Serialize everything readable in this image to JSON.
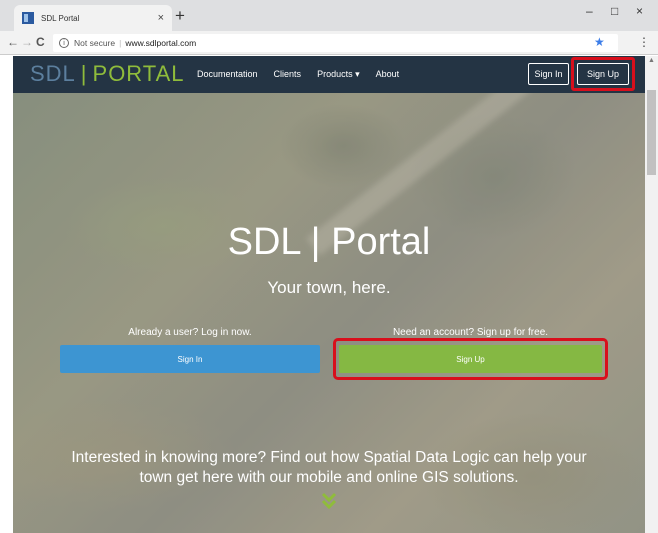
{
  "browser": {
    "tab_title": "SDL Portal",
    "tab_close": "×",
    "new_tab": "+",
    "window_controls": {
      "minimize": "–",
      "maximize": "□",
      "close": "×"
    },
    "nav": {
      "back": "←",
      "forward": "→",
      "reload": "C"
    },
    "security_label": "Not secure",
    "url": "www.sdlportal.com",
    "info_icon": "i"
  },
  "site": {
    "logo": {
      "left": "SDL",
      "separator": "|",
      "right": "PORTAL"
    },
    "nav_links": [
      "Documentation",
      "Clients",
      "Products ▾",
      "About"
    ],
    "sign_in_label": "Sign In",
    "sign_up_label": "Sign Up"
  },
  "hero": {
    "title": "SDL | Portal",
    "subtitle": "Your town, here.",
    "login_prompt": "Already a user? Log in now.",
    "signup_prompt": "Need an account? Sign up for free.",
    "sign_in_button": "Sign In",
    "sign_up_button": "Sign Up",
    "info_line1": "Interested in knowing more? Find out how Spatial Data Logic can help your",
    "info_line2": "town get here with our mobile and online GIS solutions."
  },
  "colors": {
    "navbar": "#243444",
    "accent_green": "#8fbc3b",
    "sign_in_blue": "#3d95d2",
    "highlight_red": "#d80f1c"
  },
  "icons": {
    "chevron": "chevron-double-down-icon",
    "star": "bookmark-star-icon",
    "menu": "kebab-menu-icon"
  }
}
